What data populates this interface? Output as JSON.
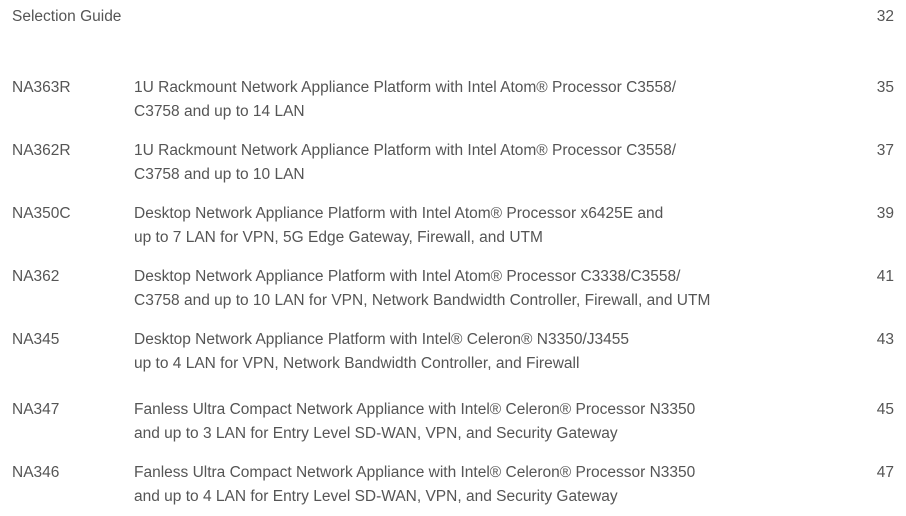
{
  "selection_guide": {
    "title": "Selection Guide",
    "page": "32"
  },
  "entries": [
    {
      "model": "NA363R",
      "line1": "1U Rackmount Network Appliance Platform with Intel Atom® Processor C3558/",
      "line2": "C3758 and up to 14 LAN",
      "page": "35"
    },
    {
      "model": "NA362R",
      "line1": "1U Rackmount Network Appliance Platform with Intel Atom® Processor C3558/",
      "line2": "C3758 and up to 10 LAN",
      "page": "37"
    },
    {
      "model": "NA350C",
      "line1": "Desktop Network Appliance Platform with Intel Atom® Processor x6425E and",
      "line2": "up to 7 LAN for VPN, 5G Edge Gateway, Firewall, and UTM",
      "page": "39"
    },
    {
      "model": "NA362",
      "line1": "Desktop Network Appliance Platform with Intel Atom® Processor C3338/C3558/",
      "line2": "C3758 and up to 10 LAN for VPN, Network Bandwidth Controller, Firewall, and UTM",
      "page": "41"
    },
    {
      "model": "NA345",
      "line1": "Desktop Network Appliance Platform with Intel® Celeron® N3350/J3455",
      "line2": "up to 4 LAN for VPN, Network Bandwidth Controller, and Firewall",
      "page": "43"
    },
    {
      "model": "NA347",
      "line1": "Fanless Ultra Compact Network Appliance with Intel® Celeron® Processor N3350",
      "line2": "and up to 3 LAN for Entry Level SD-WAN, VPN, and Security Gateway",
      "page": "45"
    },
    {
      "model": "NA346",
      "line1": "Fanless Ultra Compact Network Appliance with Intel® Celeron® Processor N3350",
      "line2": "and up to 4 LAN for Entry Level SD-WAN, VPN, and Security Gateway",
      "page": "47"
    }
  ]
}
